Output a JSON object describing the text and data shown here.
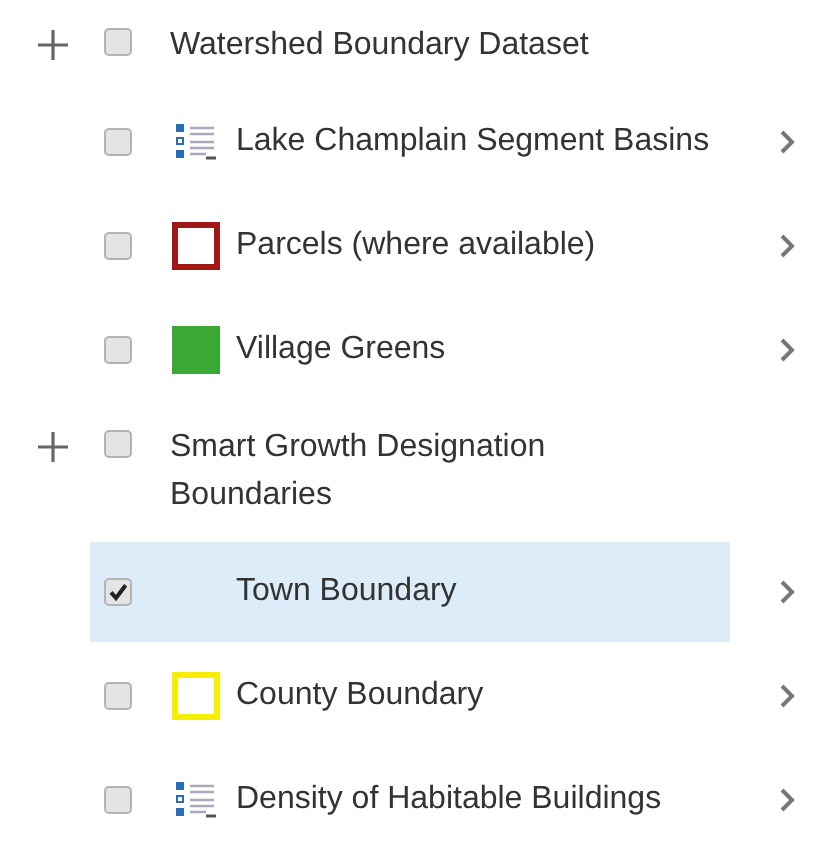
{
  "layers": [
    {
      "kind": "group",
      "label": "Watershed Boundary Dataset",
      "checked": false,
      "expanded": false
    },
    {
      "kind": "layer",
      "label": "Lake Champlain Segment Basins",
      "checked": false,
      "selected": false,
      "swatch": {
        "kind": "legend"
      }
    },
    {
      "kind": "layer",
      "label": "Parcels (where available)",
      "checked": false,
      "selected": false,
      "swatch": {
        "kind": "outline",
        "color": "#a01818"
      }
    },
    {
      "kind": "layer",
      "label": "Village Greens",
      "checked": false,
      "selected": false,
      "swatch": {
        "kind": "fill",
        "color": "#3aa832"
      }
    },
    {
      "kind": "group",
      "label": "Smart Growth Designation Boundaries",
      "checked": false,
      "expanded": false
    },
    {
      "kind": "layer",
      "label": "Town Boundary",
      "checked": true,
      "selected": true
    },
    {
      "kind": "layer",
      "label": "County Boundary",
      "checked": false,
      "selected": false,
      "swatch": {
        "kind": "outline",
        "color": "#f5ee00"
      }
    },
    {
      "kind": "layer",
      "label": "Density of Habitable Buildings",
      "checked": false,
      "selected": false,
      "swatch": {
        "kind": "legend"
      }
    }
  ]
}
